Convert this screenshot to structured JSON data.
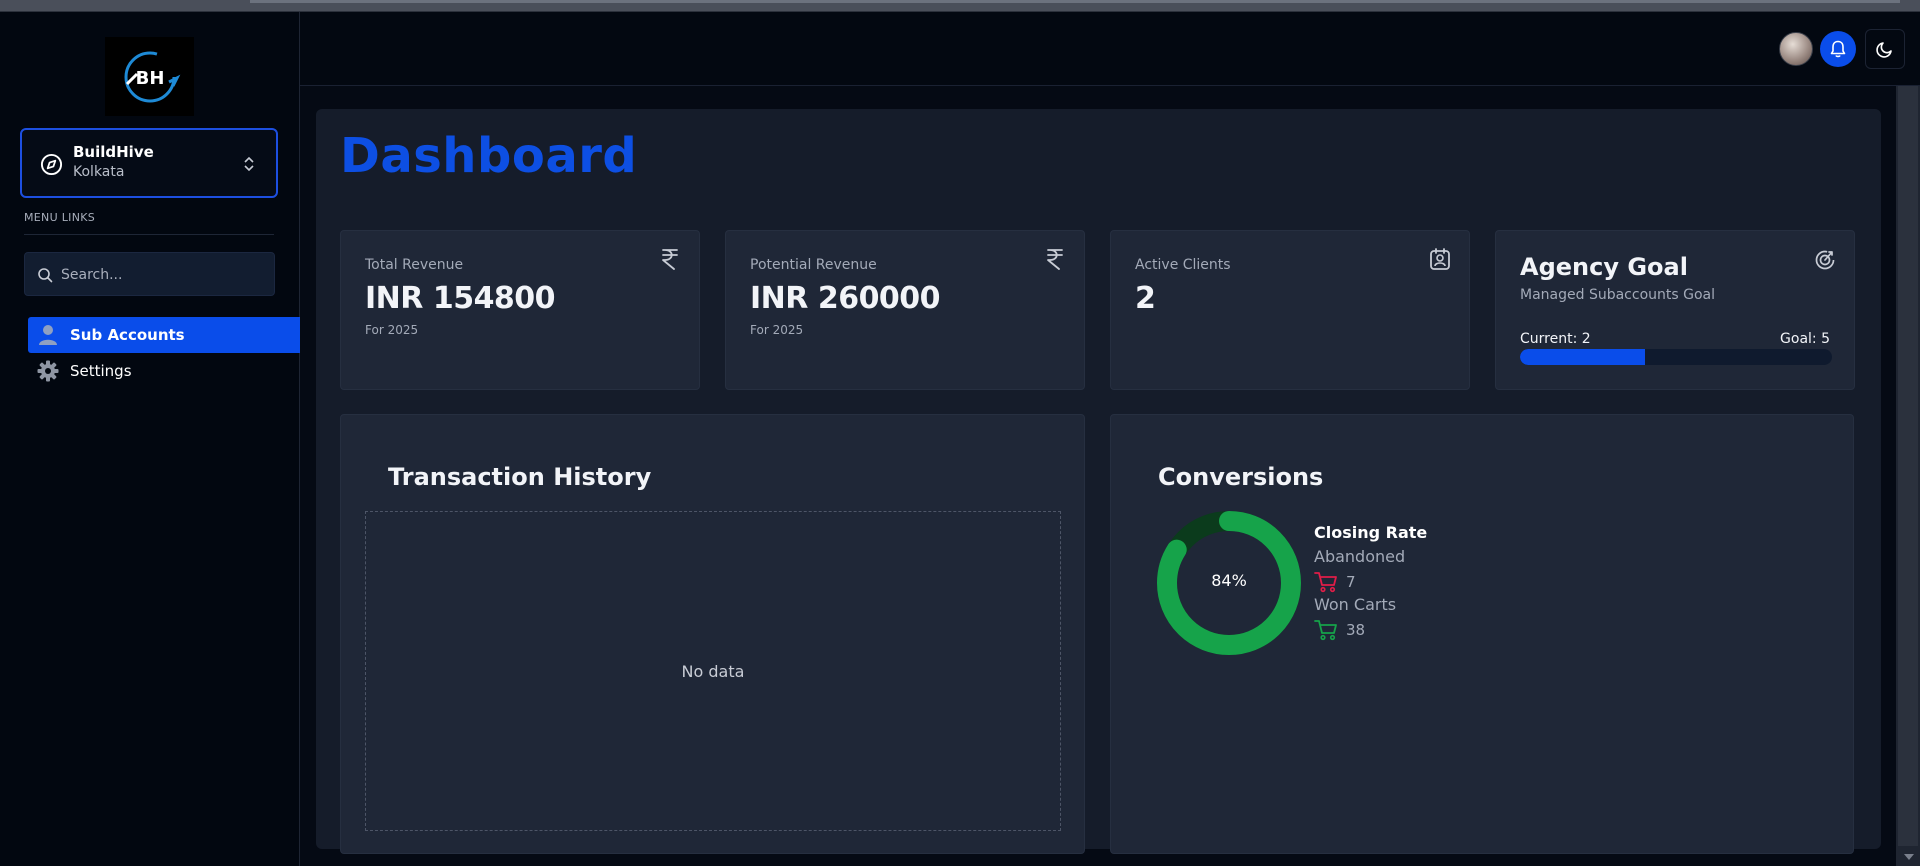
{
  "brand": {
    "logo_text": "BH"
  },
  "org": {
    "name": "BuildHive",
    "location": "Kolkata"
  },
  "sidebar": {
    "section_label": "MENU LINKS",
    "search_placeholder": "Search...",
    "items": [
      {
        "label": "Sub Accounts",
        "icon": "user-icon",
        "active": true
      },
      {
        "label": "Settings",
        "icon": "gear-icon",
        "active": false
      }
    ]
  },
  "header": {
    "avatar": "user-avatar",
    "bell": "bell-icon",
    "theme": "moon-icon"
  },
  "page": {
    "title": "Dashboard"
  },
  "cards": {
    "total_revenue": {
      "label": "Total Revenue",
      "value": "INR 154800",
      "sub": "For 2025",
      "icon": "rupee-icon"
    },
    "potential_revenue": {
      "label": "Potential Revenue",
      "value": "INR 260000",
      "sub": "For 2025",
      "icon": "rupee-icon"
    },
    "active_clients": {
      "label": "Active Clients",
      "value": "2",
      "icon": "contact-icon"
    },
    "agency_goal": {
      "title": "Agency Goal",
      "subtitle": "Managed Subaccounts Goal",
      "current_label": "Current: 2",
      "goal_label": "Goal: 5",
      "progress": 0.4,
      "icon": "target-icon"
    }
  },
  "transactions": {
    "title": "Transaction History",
    "empty_text": "No data"
  },
  "conversions": {
    "title": "Conversions",
    "percent_label": "84%",
    "percent": 84,
    "closing_rate_label": "Closing Rate",
    "abandoned_label": "Abandoned",
    "abandoned_count": "7",
    "won_label": "Won Carts",
    "won_count": "38"
  },
  "colors": {
    "accent": "#0a4dea",
    "donut_fill": "#16a34a",
    "donut_track": "#0b3b1c",
    "abandoned_cart": "#e11d48",
    "won_cart": "#16a34a"
  }
}
